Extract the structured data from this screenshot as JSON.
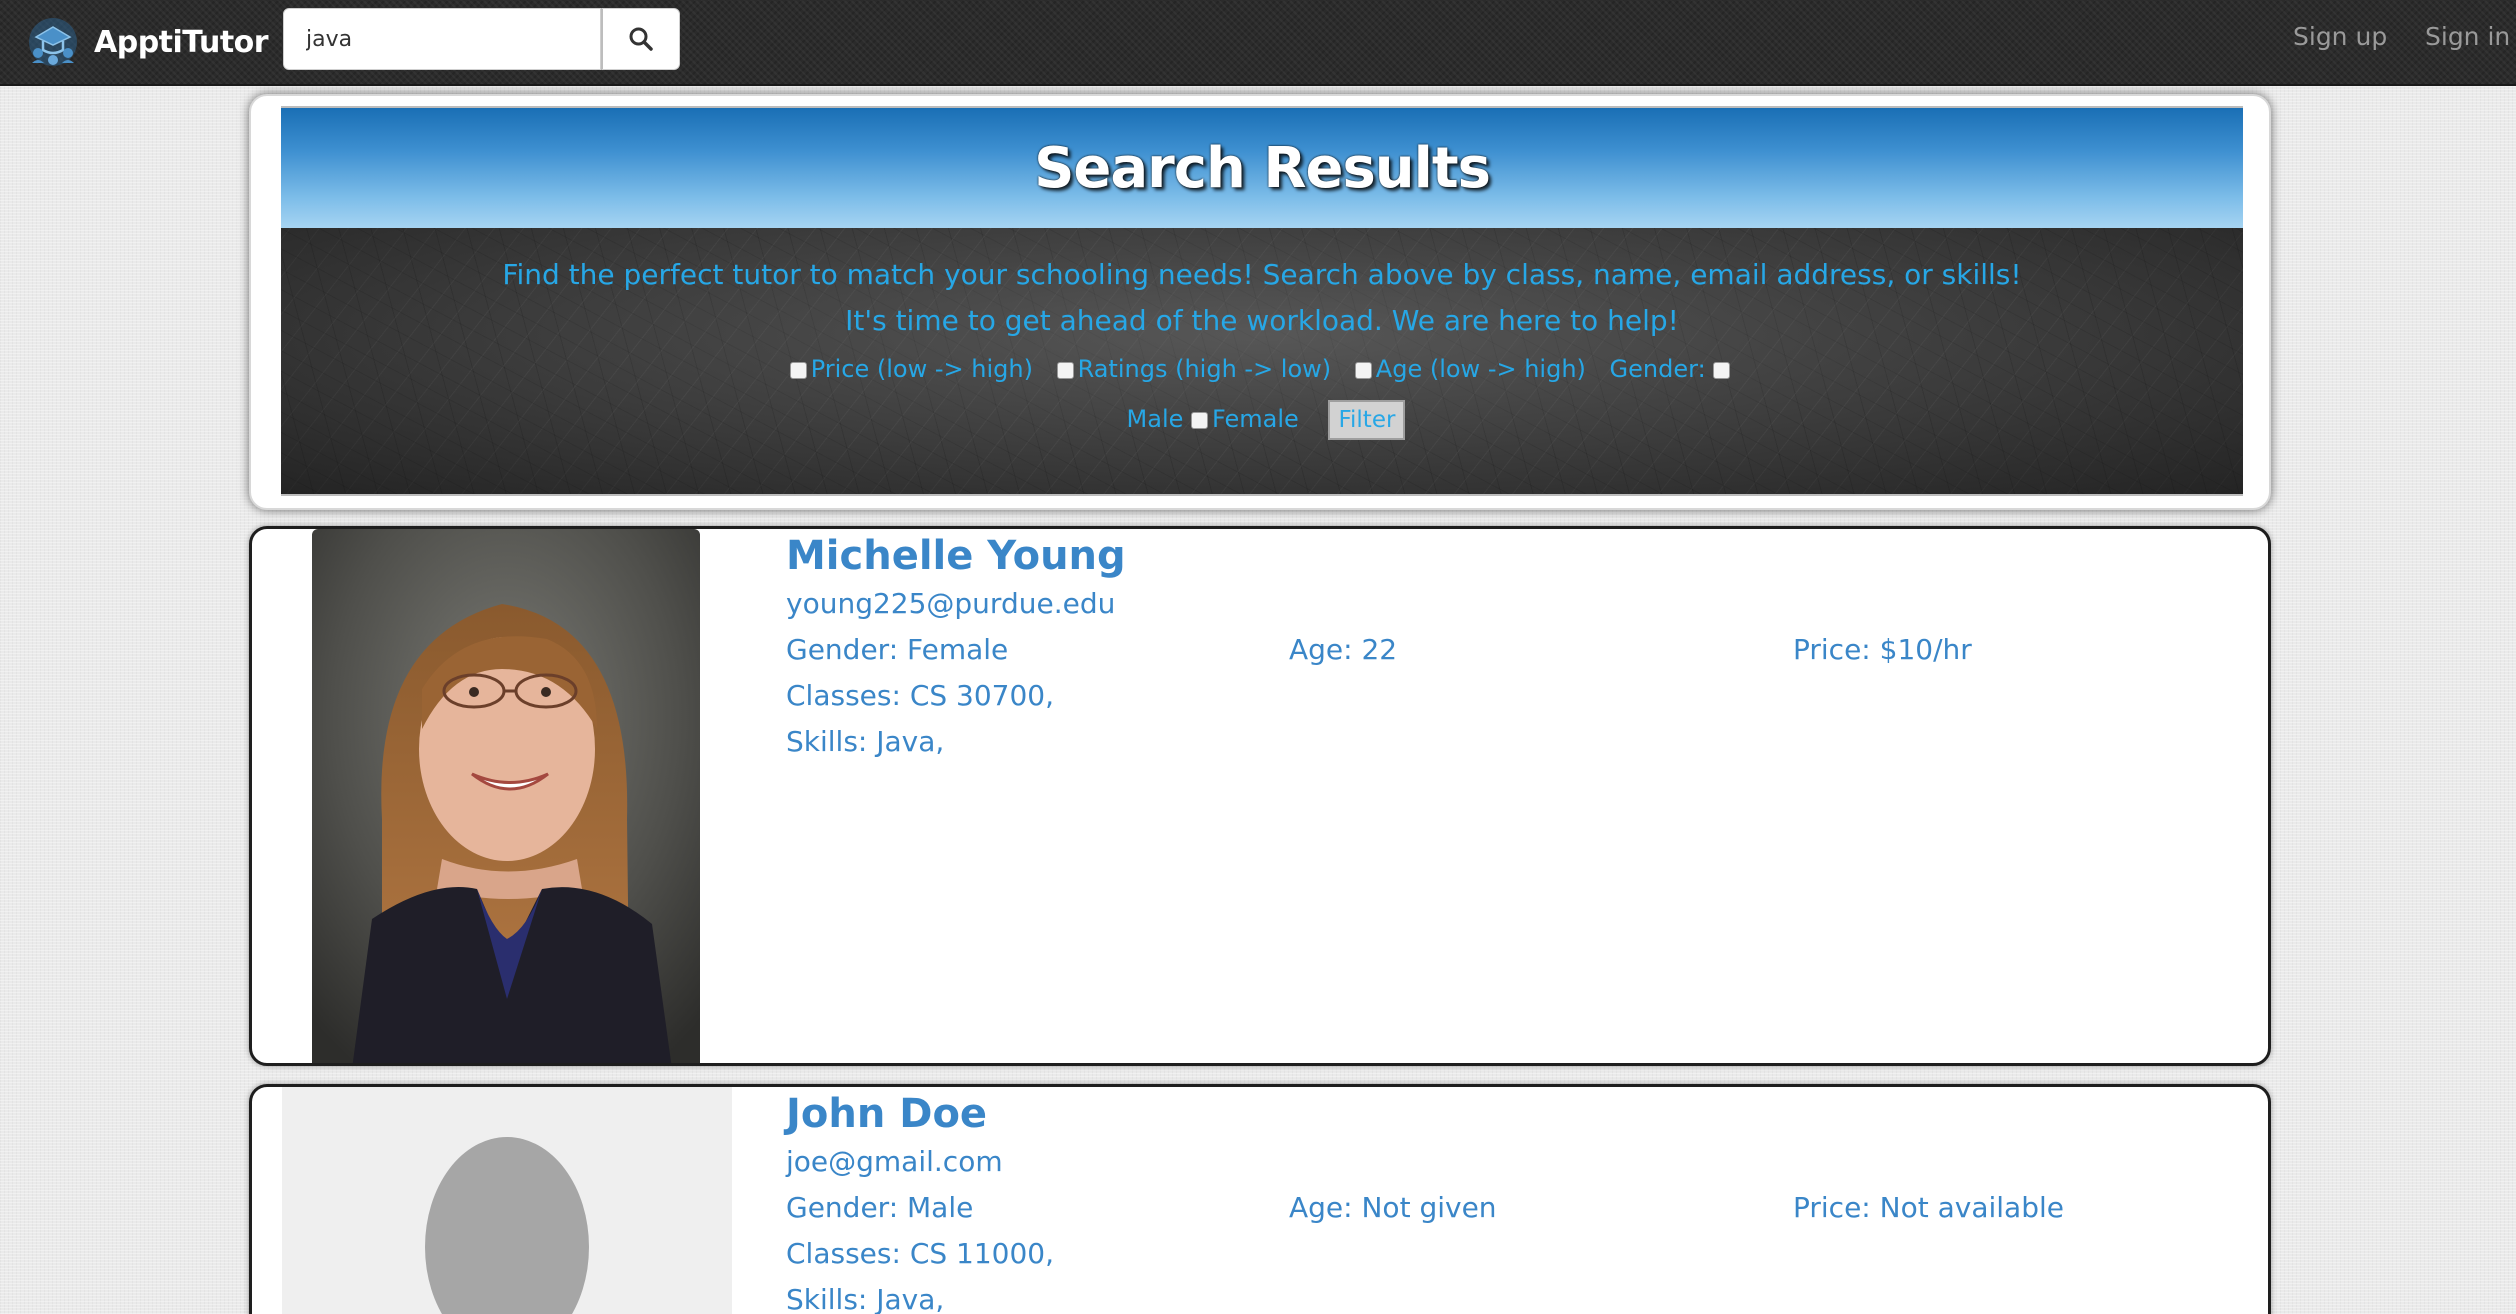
{
  "navbar": {
    "brand": "ApptiTutor",
    "search_value": "java",
    "sign_up": "Sign up",
    "sign_in": "Sign in"
  },
  "header": {
    "title": "Search Results",
    "tagline_1": "Find the perfect tutor to match your schooling needs! Search above by class, name, email address, or skills!",
    "tagline_2": "It's time to get ahead of the workload. We are here to help!",
    "filters": {
      "price": "Price (low -> high)",
      "ratings": "Ratings (high -> low)",
      "age": "Age (low -> high)",
      "gender_label": "Gender:",
      "male": "Male",
      "female": "Female",
      "filter_button": "Filter"
    }
  },
  "tutors": [
    {
      "name": "Michelle Young",
      "email": "young225@purdue.edu",
      "gender": "Gender: Female",
      "age": "Age: 22",
      "price": "Price: $10/hr",
      "classes": "Classes: CS 30700,",
      "skills": "Skills: Java,"
    },
    {
      "name": "John Doe",
      "email": "joe@gmail.com",
      "gender": "Gender: Male",
      "age": "Age: Not given",
      "price": "Price: Not available",
      "classes": "Classes: CS 11000,",
      "skills": "Skills: Java,"
    }
  ],
  "colors": {
    "accent_text": "#3a86c8",
    "header_text": "#27a7e6",
    "navbar_bg": "#2b2b2b"
  }
}
